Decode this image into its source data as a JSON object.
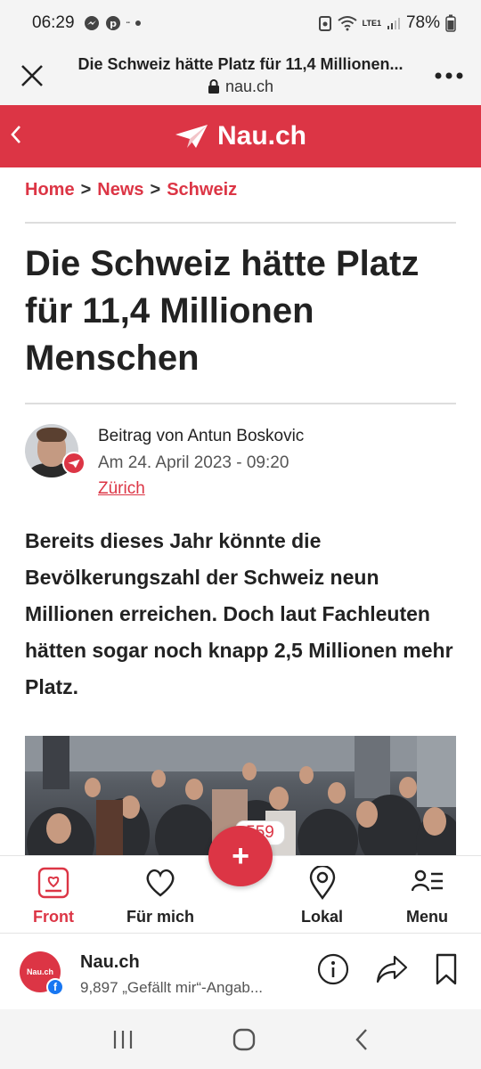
{
  "status_bar": {
    "time": "06:29",
    "battery": "78%",
    "network": "LTE1"
  },
  "browser": {
    "page_title": "Die Schweiz hätte Platz für 11,4 Millionen...",
    "url": "nau.ch"
  },
  "site": {
    "logo_text": "Nau.ch",
    "brand_color": "#dc3545"
  },
  "breadcrumb": {
    "items": [
      "Home",
      "News",
      "Schweiz"
    ],
    "separator": ">"
  },
  "article": {
    "headline": "Die Schweiz hätte Platz für 11,4 Millionen Menschen",
    "author_line": "Beitrag von Antun Boskovic",
    "date_line": "Am 24. April 2023 - 09:20",
    "location": "Zürich",
    "lead": "Bereits dieses Jahr könnte die Bevölkerungszahl der Schweiz neun Millionen erreichen. Doch laut Fachleuten hätten sogar noch knapp 2,5 Millionen mehr Platz."
  },
  "comments": {
    "count": "559",
    "add_label": "+"
  },
  "bottom_nav": {
    "items": [
      {
        "label": "Front",
        "icon": "front-icon",
        "active": true
      },
      {
        "label": "Für mich",
        "icon": "heart-icon",
        "active": false
      },
      {
        "label": "Lokal",
        "icon": "location-pin-icon",
        "active": false
      },
      {
        "label": "Menu",
        "icon": "menu-icon",
        "active": false
      }
    ]
  },
  "facebook_bar": {
    "avatar_text": "Nau.ch",
    "page_name": "Nau.ch",
    "likes": "9,897 „Gefällt mir“-Angab..."
  }
}
